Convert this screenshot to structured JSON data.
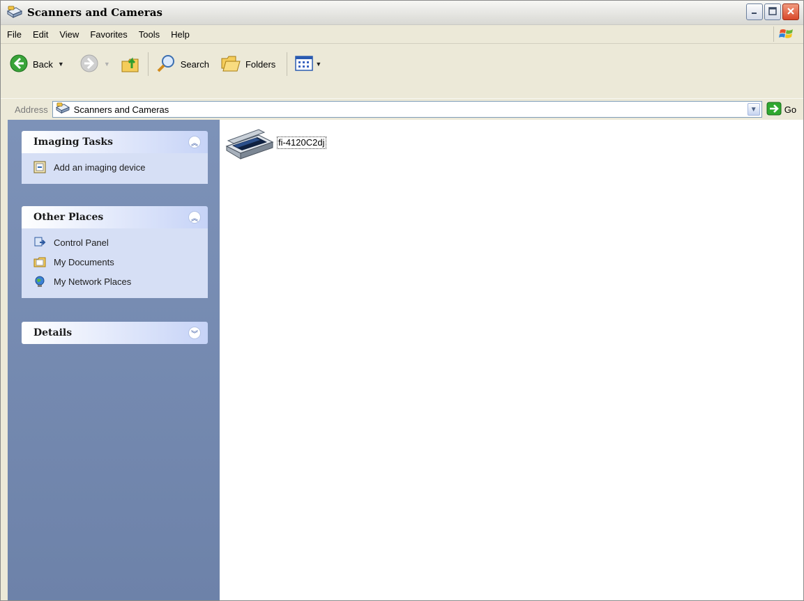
{
  "window": {
    "title": "Scanners and Cameras"
  },
  "menubar": {
    "items": [
      "File",
      "Edit",
      "View",
      "Favorites",
      "Tools",
      "Help"
    ]
  },
  "toolbar": {
    "back_label": "Back",
    "search_label": "Search",
    "folders_label": "Folders"
  },
  "address": {
    "label": "Address",
    "value": "Scanners and Cameras",
    "go_label": "Go"
  },
  "tasks": {
    "imaging": {
      "title": "Imaging Tasks",
      "items": [
        "Add an imaging device"
      ]
    },
    "other_places": {
      "title": "Other Places",
      "items": [
        "Control Panel",
        "My Documents",
        "My Network Places"
      ]
    },
    "details": {
      "title": "Details"
    }
  },
  "content": {
    "devices": [
      {
        "label": "fi-4120C2dj",
        "icon": "scanner-icon"
      }
    ]
  },
  "colors": {
    "taskpane_bg": "#7084aa",
    "group_body": "#d6dff5",
    "close_button": "#d8482a",
    "go_green": "#2fa82f"
  }
}
